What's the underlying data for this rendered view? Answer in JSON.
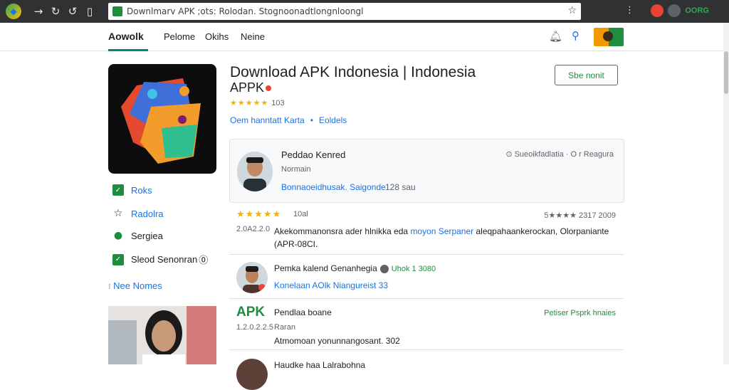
{
  "browser": {
    "url": "Downlmarv APK ;ots: Rolodan. Stognoonadtlongnloongl",
    "status_text": "OORG"
  },
  "site": {
    "brand": "Aowolk",
    "nav": [
      "Pelome",
      "Okihs",
      "Neine"
    ]
  },
  "sidebar": {
    "items": [
      {
        "label": "Roks",
        "icon": "checkbox-icon"
      },
      {
        "label": "Radolra",
        "icon": "star-outline-icon"
      },
      {
        "label": "Sergiea",
        "icon": "chat-bubble-icon"
      },
      {
        "label": "Sleod Senonran",
        "icon": "checkbox-icon",
        "suffix": "⓪"
      }
    ],
    "more_label": "Nee Nomes"
  },
  "app": {
    "title": "Download APK Indonesia | Indonesia",
    "subtitle": "APPK",
    "rating_stars": "★★★★★",
    "rating_count": "103",
    "meta_link_1": "Oem hanntatt Karta",
    "meta_sep": "•",
    "meta_link_2": "Eoldels",
    "install_label": "Sbe nonit"
  },
  "developer": {
    "name": "Peddao Kenred",
    "role": "Normain",
    "link": "Bonnaoeidhusak. Saigonde",
    "count": "128 sau",
    "right_text": "⊙ Sueoikfadlatia · O r Reagura"
  },
  "review_1": {
    "stars": "★★★★★",
    "score": "10al",
    "date": "2.0A2.2.0",
    "right": "5★★★★ 2317 2009",
    "text_before": "Akekommanonsra ader hlnikka eda ",
    "text_highlight": "moyon Serpaner",
    "text_after": " aleqpahaankerockan, Olorpaniante (APR-08CI."
  },
  "reviewer_1": {
    "name": "Pemka kalend Genanhegia",
    "green_text": "Uhok 1 3080",
    "sub": "Konelaan AOlk Niangureist 33"
  },
  "apk_entry": {
    "logo": "APK",
    "date": "1.2.0.2.2.5",
    "name": "Pendlaa boane",
    "sub": "Raran",
    "right": "Petiser Psprk hnaies",
    "text": "Atmomoan yonunnangosant. 302"
  },
  "peek": {
    "text": "Haudke haa Lalrabohna"
  }
}
